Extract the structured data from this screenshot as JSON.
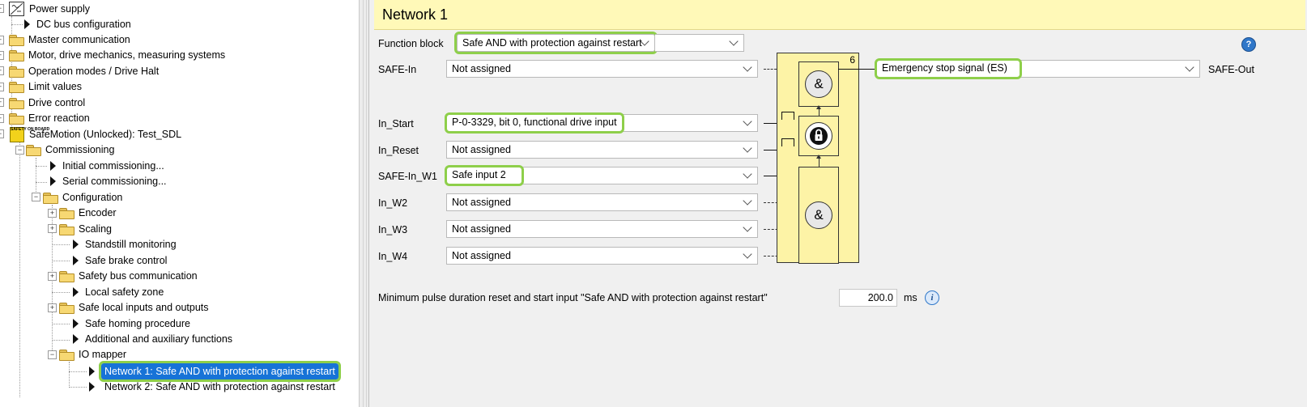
{
  "tree": {
    "items": [
      {
        "label": "Power supply"
      },
      {
        "label": "DC bus configuration"
      },
      {
        "label": "Master communication"
      },
      {
        "label": "Motor, drive mechanics, measuring systems"
      },
      {
        "label": "Operation modes / Drive Halt"
      },
      {
        "label": "Limit values"
      },
      {
        "label": "Drive control"
      },
      {
        "label": "Error reaction"
      },
      {
        "label": "SafeMotion (Unlocked): Test_SDL"
      },
      {
        "label": "Commissioning"
      },
      {
        "label": "Initial commissioning..."
      },
      {
        "label": "Serial commissioning..."
      },
      {
        "label": "Configuration"
      },
      {
        "label": "Encoder"
      },
      {
        "label": "Scaling"
      },
      {
        "label": "Standstill monitoring"
      },
      {
        "label": "Safe brake control"
      },
      {
        "label": "Safety bus communication"
      },
      {
        "label": "Local safety zone"
      },
      {
        "label": "Safe local inputs and outputs"
      },
      {
        "label": "Safe homing procedure"
      },
      {
        "label": "Additional and auxiliary functions"
      },
      {
        "label": "IO mapper"
      },
      {
        "label": "Network 1: Safe AND with protection against restart"
      },
      {
        "label": "Network 2: Safe AND with protection against restart"
      }
    ],
    "safe_icon_text": "SAFETY ON BOARD"
  },
  "header": {
    "title": "Network 1"
  },
  "function_block": {
    "label": "Function block",
    "value": "Safe AND with protection against restart"
  },
  "inputs": [
    {
      "label": "SAFE-In",
      "value": "Not assigned"
    },
    {
      "label": "In_Start",
      "value": "P-0-3329, bit 0, functional drive input"
    },
    {
      "label": "In_Reset",
      "value": "Not assigned"
    },
    {
      "label": "SAFE-In_W1",
      "value": "Safe input 2"
    },
    {
      "label": "In_W2",
      "value": "Not assigned"
    },
    {
      "label": "In_W3",
      "value": "Not assigned"
    },
    {
      "label": "In_W4",
      "value": "Not assigned"
    }
  ],
  "output": {
    "label": "SAFE-Out",
    "value": "Emergency stop signal (ES)"
  },
  "block": {
    "number": "6",
    "and_symbol": "&"
  },
  "pulse": {
    "label": "Minimum pulse duration reset and start input \"Safe AND with protection against restart\"",
    "value": "200.0",
    "unit": "ms"
  },
  "icons": {
    "help": "help-icon",
    "info": "info-icon",
    "lock": "lock-icon",
    "folder": "folder-icon",
    "arrow": "arrow-icon"
  },
  "colors": {
    "header_bg": "#fff9b8",
    "block_fill": "#fdf3a6",
    "highlight": "#8ecf4a",
    "selection": "#1773d7"
  }
}
